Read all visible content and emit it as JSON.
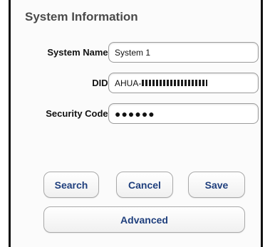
{
  "panel": {
    "title": "System Information"
  },
  "form": {
    "system_name": {
      "label": "System Name:",
      "value": "System 1"
    },
    "did": {
      "label": "DID:",
      "value_prefix": "AHUA-"
    },
    "security_code": {
      "label": "Security Code:",
      "value": "●●●●●●"
    }
  },
  "buttons": {
    "search": "Search",
    "cancel": "Cancel",
    "save": "Save",
    "advanced": "Advanced"
  },
  "colors": {
    "button_text": "#1f3f7d",
    "title_text": "#4a4a4a"
  }
}
